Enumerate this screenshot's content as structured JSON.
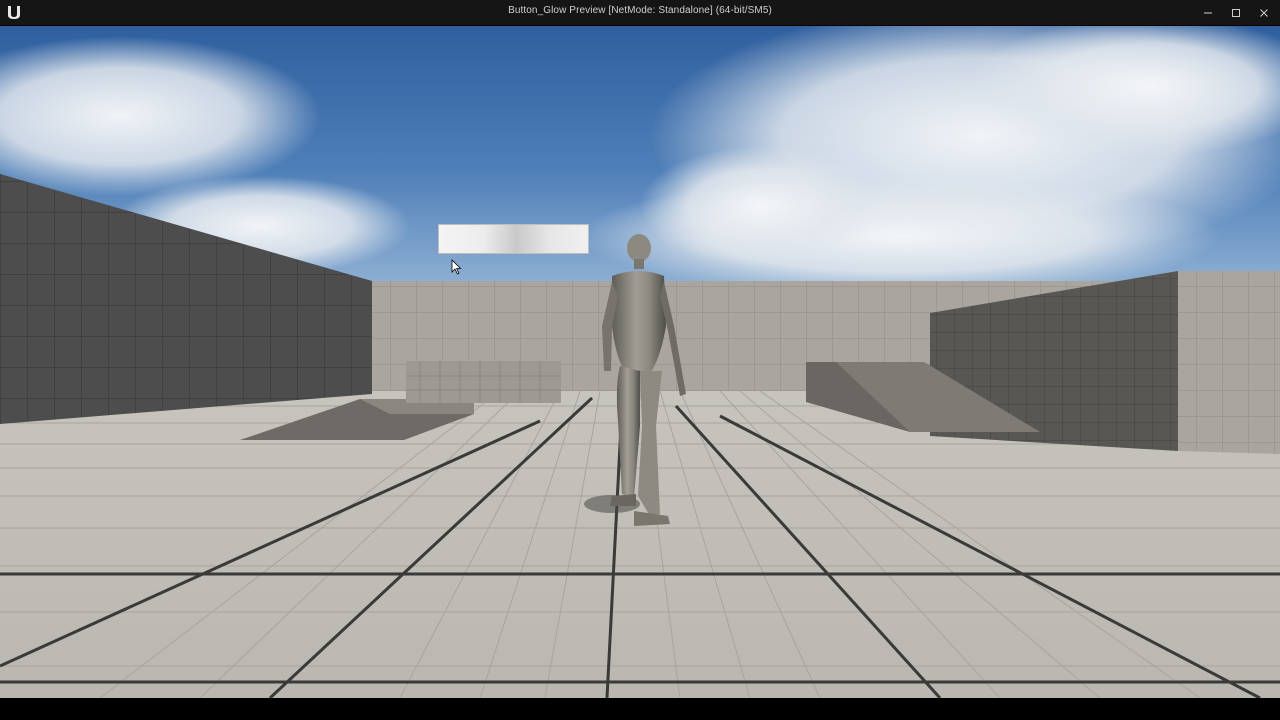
{
  "window": {
    "title": "Button_Glow Preview [NetMode: Standalone]  (64-bit/SM5)",
    "controls": [
      "minimize",
      "maximize",
      "close"
    ]
  },
  "viewport": {
    "scene": "third-person-template-level",
    "icons": {
      "app_logo": "unreal-engine-logo",
      "cursor": "mouse-pointer-icon"
    },
    "colors": {
      "sky_top": "#2f5f9e",
      "sky_bottom": "#7ea3c9",
      "floor": "#bfbcb6",
      "wall": "#a9a59f",
      "dark_wall": "#4a4a4a"
    }
  },
  "ui_widget": {
    "name": "glow-button",
    "label": ""
  }
}
